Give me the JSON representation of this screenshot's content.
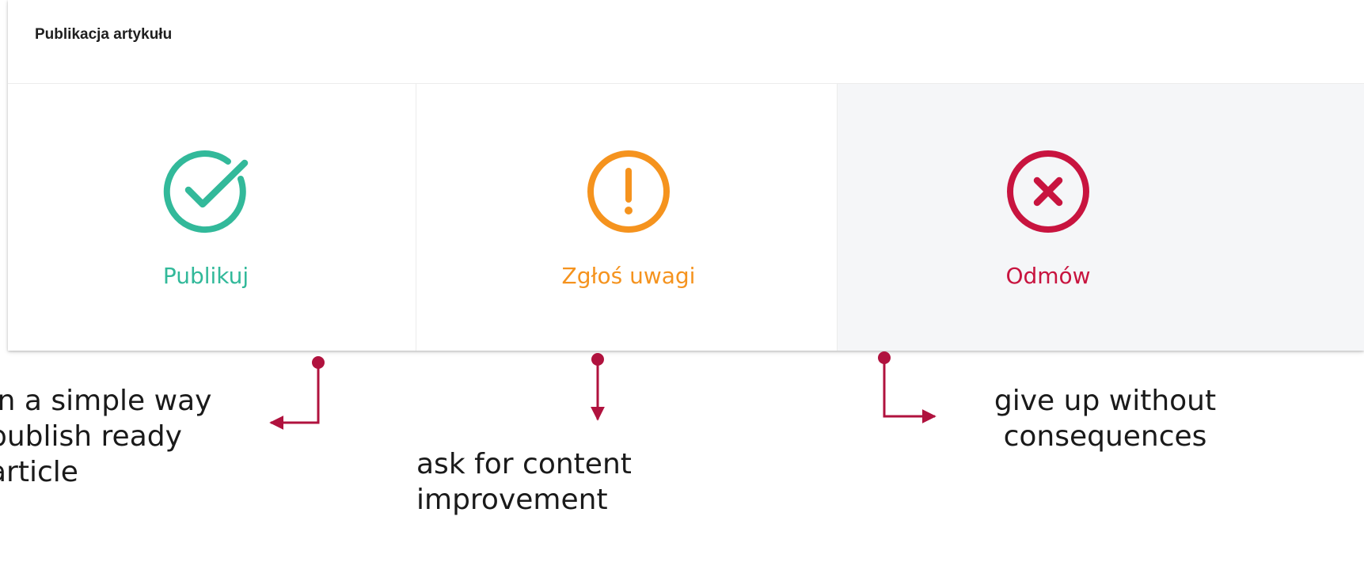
{
  "panel": {
    "title": "Publikacja artykułu"
  },
  "actions": [
    {
      "label": "Publikuj",
      "icon": "check-circle-icon",
      "color": "#32b99a"
    },
    {
      "label": "Zgłoś uwagi",
      "icon": "exclamation-circle-icon",
      "color": "#f5931e"
    },
    {
      "label": "Odmów",
      "icon": "x-circle-icon",
      "color": "#c8143f",
      "background": "#f5f6f8"
    }
  ],
  "annotations": {
    "color": "#b0123e",
    "publish": [
      "In a simple way",
      "publish ready",
      "article"
    ],
    "remarks": [
      "ask for content",
      "improvement"
    ],
    "reject": [
      "give up without",
      "consequences"
    ]
  }
}
